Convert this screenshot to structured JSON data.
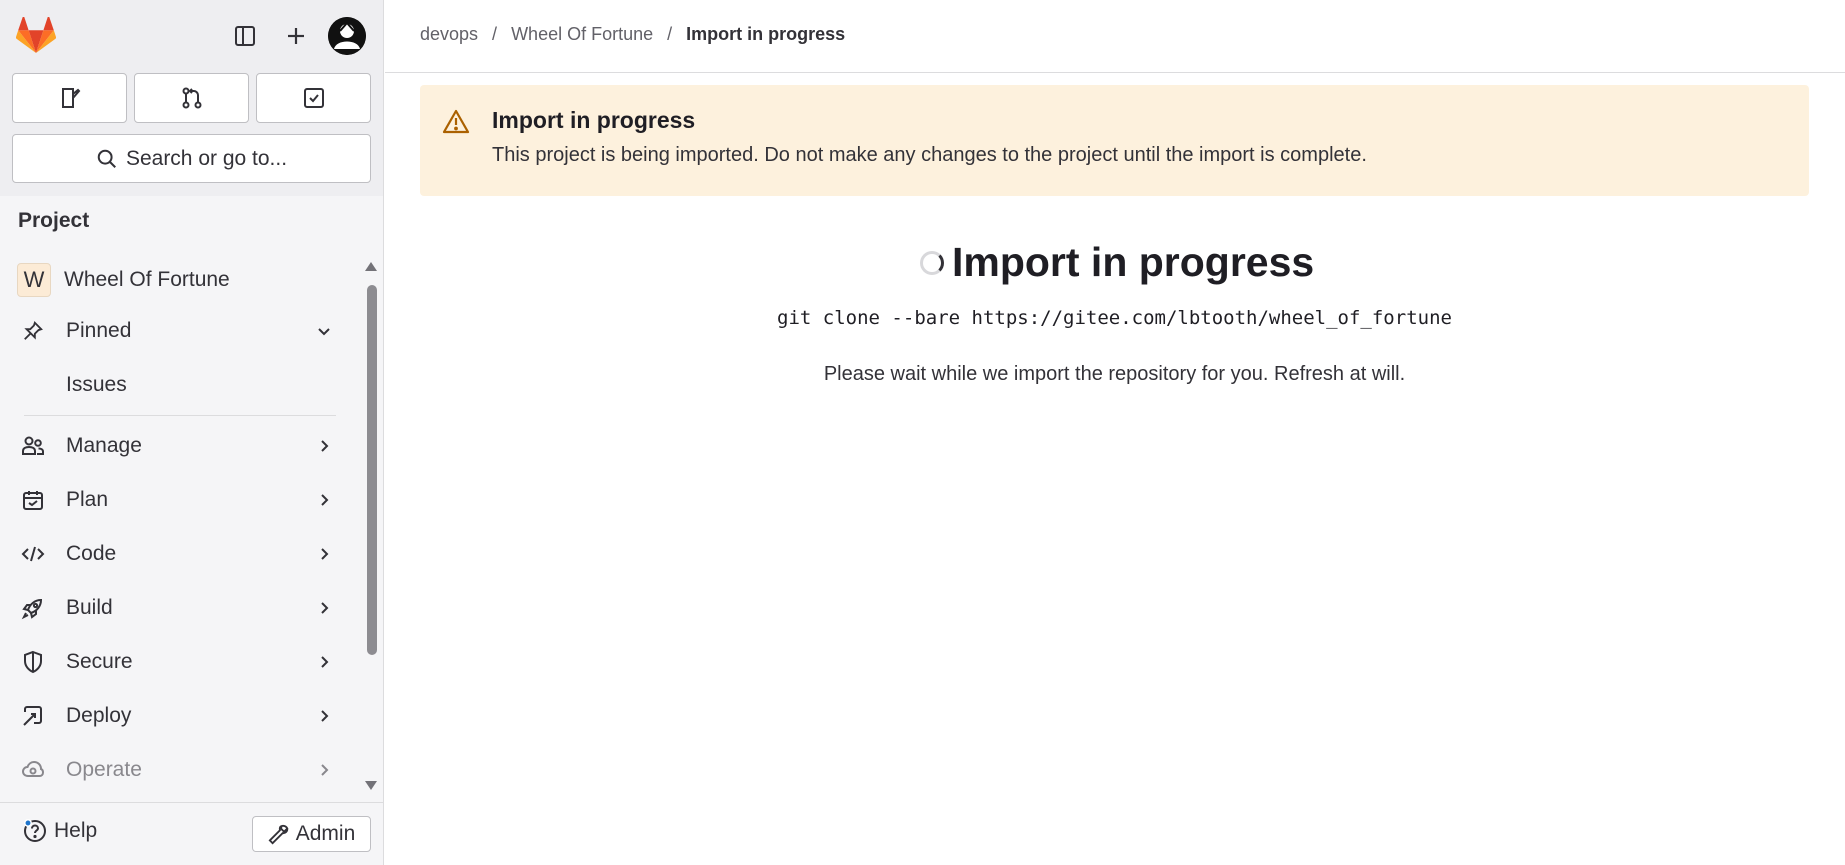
{
  "sidebar": {
    "search_label": "Search or go to...",
    "section_title": "Project",
    "project_name": "Wheel Of Fortune",
    "project_initial": "W",
    "pinned_label": "Pinned",
    "pinned_items": [
      "Issues"
    ],
    "nav_items": [
      {
        "label": "Manage",
        "icon": "users-icon"
      },
      {
        "label": "Plan",
        "icon": "calendar-icon"
      },
      {
        "label": "Code",
        "icon": "code-icon"
      },
      {
        "label": "Build",
        "icon": "rocket-icon"
      },
      {
        "label": "Secure",
        "icon": "shield-icon"
      },
      {
        "label": "Deploy",
        "icon": "deploy-icon"
      },
      {
        "label": "Operate",
        "icon": "cloud-icon"
      }
    ],
    "help_label": "Help",
    "admin_label": "Admin"
  },
  "breadcrumb": {
    "items": [
      "devops",
      "Wheel Of Fortune"
    ],
    "separator": "/",
    "current": "Import in progress"
  },
  "alert": {
    "title": "Import in progress",
    "body": "This project is being imported. Do not make any changes to the project until the import is complete."
  },
  "main": {
    "title": "Import in progress",
    "git_command": "git clone --bare https://gitee.com/lbtooth/wheel_of_fortune",
    "message": "Please wait while we import the repository for you. Refresh at will."
  },
  "colors": {
    "brand_orange": "#fc6d26",
    "alert_bg": "#fdf1dd",
    "warning_icon": "#ab6100"
  }
}
